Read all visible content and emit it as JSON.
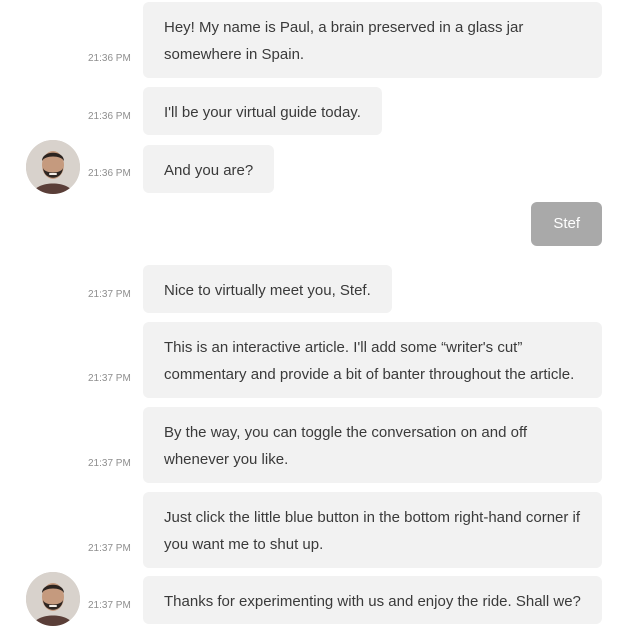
{
  "messages": [
    {
      "time": "21:36 PM",
      "text": "Hey! My name is Paul, a brain preserved in a glass jar somewhere in Spain."
    },
    {
      "time": "21:36 PM",
      "text": "I'll be your virtual guide today."
    },
    {
      "time": "21:36 PM",
      "text": "And you are?"
    },
    {
      "time": "21:37 PM",
      "text": "Nice to virtually meet you, Stef."
    },
    {
      "time": "21:37 PM",
      "text": "This is an interactive article. I'll add some “writer's cut” commentary and provide a bit of banter throughout the article."
    },
    {
      "time": "21:37 PM",
      "text": "By the way, you can toggle the conversation on and off whenever you like."
    },
    {
      "time": "21:37 PM",
      "text": "Just click the little blue button in the bottom right-hand corner if you want me to shut up."
    },
    {
      "time": "21:37 PM",
      "text": "Thanks for experimenting with us and enjoy the ride. Shall we?"
    }
  ],
  "user_reply": "Stef",
  "avatar_icon": "person-avatar-icon"
}
